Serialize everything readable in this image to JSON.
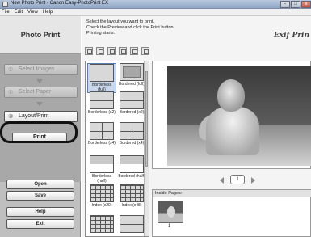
{
  "window": {
    "title": "New Photo Print - Canon Easy-PhotoPrint EX",
    "min": "-",
    "max": "□",
    "close": "x"
  },
  "menu": [
    "File",
    "Edit",
    "View",
    "Help"
  ],
  "left": {
    "logo": "Photo Print",
    "steps": [
      {
        "num": "①",
        "label": "Select Images"
      },
      {
        "num": "②",
        "label": "Select Paper"
      },
      {
        "num": "③",
        "label": "Layout/Print"
      }
    ],
    "print_label": "Print",
    "buttons": {
      "open": "Open",
      "save": "Save",
      "help": "Help",
      "exit": "Exit"
    }
  },
  "main": {
    "instructions": [
      "Select the layout you want to print.",
      "Check the Preview and click the Print button.",
      "Printing starts."
    ],
    "brand": "Exif Prin",
    "layouts": [
      {
        "caption": "Borderless (full)"
      },
      {
        "caption": "Bordered (full)"
      },
      {
        "caption": "Borderless (x2)"
      },
      {
        "caption": "Bordered (x2)"
      },
      {
        "caption": "Borderless (x4)"
      },
      {
        "caption": "Bordered (x4)"
      },
      {
        "caption": "Borderless (half)"
      },
      {
        "caption": "Bordered (half)"
      },
      {
        "caption": "Index (x20)"
      },
      {
        "caption": "Index (x48)"
      }
    ],
    "page": "1",
    "inside_pages": {
      "label": "Inside Pages:",
      "thumb_number": "1"
    }
  }
}
